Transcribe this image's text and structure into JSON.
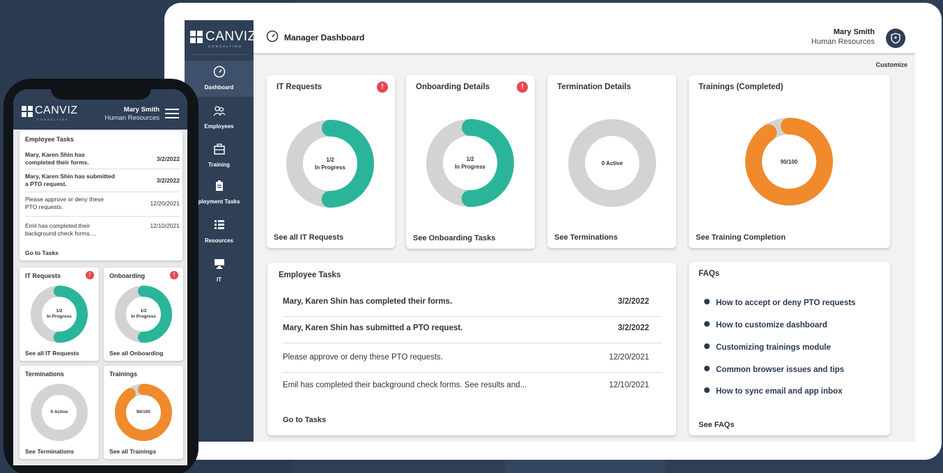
{
  "colors": {
    "accent_green": "#2ab59a",
    "accent_orange": "#f08a2c",
    "alert_red": "#e8464f",
    "navy": "#2e3f56",
    "track_gray": "#d3d3d3"
  },
  "logo": {
    "text": "CANVIZ",
    "sub": "CONSULTING"
  },
  "sidebar": {
    "items": [
      {
        "label": "Dashboard",
        "icon": "gauge-icon"
      },
      {
        "label": "Employees",
        "icon": "people-icon"
      },
      {
        "label": "Training",
        "icon": "briefcase-icon"
      },
      {
        "label": "ployment Tasks",
        "icon": "clipboard-icon"
      },
      {
        "label": "Resources",
        "icon": "list-icon"
      },
      {
        "label": "IT",
        "icon": "monitor-icon"
      }
    ]
  },
  "header": {
    "title": "Manager Dashboard",
    "user_name": "Mary Smith",
    "user_role": "Human Resources",
    "customize": "Customize"
  },
  "cards": {
    "it": {
      "title": "IT Requests",
      "center_top": "1/2",
      "center_bottom": "In Progress",
      "link": "See all IT Requests",
      "alert": "!",
      "progress": 0.5
    },
    "onboarding": {
      "title": "Onboarding Details",
      "center_top": "1/2",
      "center_bottom": "In Progress",
      "link": "See Onboarding Tasks",
      "alert": "!",
      "progress": 0.5
    },
    "termination": {
      "title": "Termination Details",
      "center_top": "0 Active",
      "link": "See Terminations",
      "progress": 0
    },
    "trainings": {
      "title": "Trainings (Completed)",
      "center_top": "90/100",
      "link": "See Training Completion",
      "progress": 0.9
    }
  },
  "tasks": {
    "title": "Employee Tasks",
    "rows": [
      {
        "text": "Mary, Karen Shin has completed their forms.",
        "date": "3/2/2022"
      },
      {
        "text": "Mary, Karen Shin has submitted a PTO request.",
        "date": "3/2/2022"
      },
      {
        "text": "Please approve or deny these PTO requests.",
        "date": "12/20/2021"
      },
      {
        "text": "Emil has completed their background check forms. See results and...",
        "date": "12/10/2021"
      }
    ],
    "link": "Go to Tasks"
  },
  "faqs": {
    "title": "FAQs",
    "items": [
      "How to accept or deny PTO requests",
      "How to customize dashboard",
      "Customizing trainings module",
      "Common browser issues and tips",
      "How to sync email and app inbox"
    ],
    "link": "See FAQs"
  },
  "mobile": {
    "user_name": "Mary Smith",
    "user_role": "Human Resources",
    "tasks": {
      "title": "Employee Tasks",
      "rows": [
        {
          "text": "Mary, Karen Shin has completed their forms.",
          "date": "3/2/2022"
        },
        {
          "text": "Mary, Karen Shin has submitted a PTO request.",
          "date": "3/2/2022"
        },
        {
          "text": "Please approve or deny these PTO requests.",
          "date": "12/20/2021"
        },
        {
          "text": "Emil has completed their background check forms....",
          "date": "12/10/2021"
        }
      ],
      "link": "Go to Tasks"
    },
    "cards": {
      "it": {
        "title": "IT Requests",
        "center_top": "1/2",
        "center_bottom": "In Progress",
        "link": "See all IT Requests",
        "alert": "!"
      },
      "onboarding": {
        "title": "Onboarding",
        "center_top": "1/2",
        "center_bottom": "In Progress",
        "link": "See all Onboarding",
        "alert": "!"
      },
      "terminations": {
        "title": "Terminations",
        "center_top": "0 Active",
        "link": "See Terminations"
      },
      "trainings": {
        "title": "Trainings",
        "center_top": "90/100",
        "link": "See all Trainings"
      }
    }
  }
}
